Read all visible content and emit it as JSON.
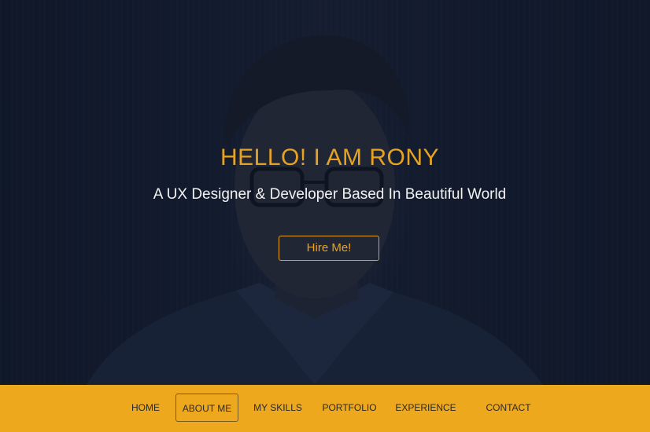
{
  "colors": {
    "accent": "#e6a323",
    "nav_background": "#eea81e",
    "hero_overlay": "#131b2e",
    "subtitle_text": "#f2f2f2"
  },
  "hero": {
    "title": "HELLO! I AM RONY",
    "subtitle": "A UX Designer & Developer Based In Beautiful World",
    "cta_label": "Hire Me!"
  },
  "nav": {
    "items": [
      {
        "label": "HOME",
        "active": false
      },
      {
        "label": "ABOUT ME",
        "active": true
      },
      {
        "label": "MY SKILLS",
        "active": false
      },
      {
        "label": "PORTFOLIO",
        "active": false
      },
      {
        "label": "EXPERIENCE",
        "active": false
      },
      {
        "label": "CONTACT",
        "active": false
      }
    ]
  }
}
